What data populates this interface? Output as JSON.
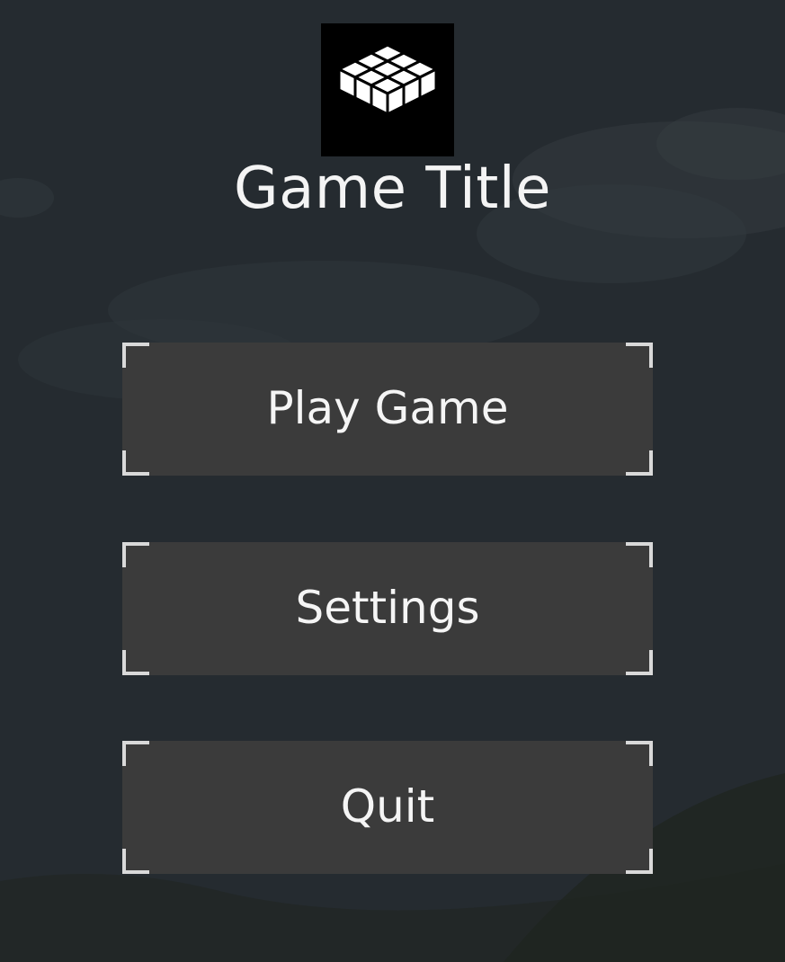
{
  "game": {
    "title": "Game Title",
    "logo_icon": "grid-cube-icon"
  },
  "menu": {
    "play_label": "Play Game",
    "settings_label": "Settings",
    "quit_label": "Quit"
  },
  "colors": {
    "background": "#252b30",
    "button_fill": "#3b3b3b",
    "button_corner": "#d9d9d9",
    "text": "#f5f5f5"
  }
}
